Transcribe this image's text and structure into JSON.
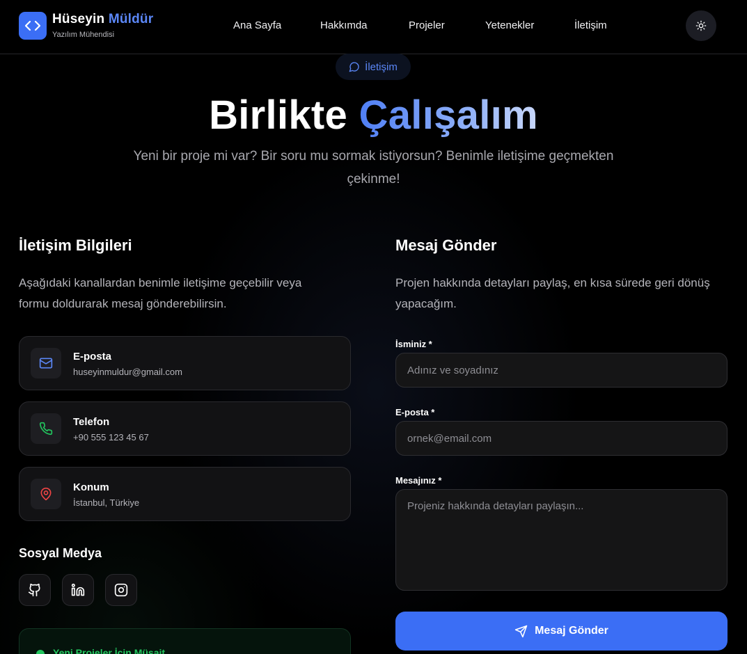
{
  "brand": {
    "first_name": "Hüseyin",
    "last_name": "Müldür",
    "subtitle": "Yazılım Mühendisi",
    "accent_color": "#3b6ef5"
  },
  "nav": {
    "links": [
      "Ana Sayfa",
      "Hakkımda",
      "Projeler",
      "Yetenekler",
      "İletişim"
    ],
    "theme_toggle_icon": "sun-icon"
  },
  "hero": {
    "badge": "İletişim",
    "badge_icon": "chat-bubble-icon",
    "title_plain": "Birlikte",
    "title_highlight": "Çalışalım",
    "subtitle": "Yeni bir proje mi var? Bir soru mu sormak istiyorsun? Benimle iletişime geçmekten çekinme!"
  },
  "contact_info": {
    "title": "İletişim Bilgileri",
    "description": "Aşağıdaki kanallardan benimle iletişime geçebilir veya formu doldurarak mesaj gönderebilirsin.",
    "items": [
      {
        "label": "E-posta",
        "value": "huseyinmuldur@gmail.com",
        "icon": "mail-icon",
        "color": "#5b87f7"
      },
      {
        "label": "Telefon",
        "value": "+90 555 123 45 67",
        "icon": "phone-icon",
        "color": "#22c55e"
      },
      {
        "label": "Konum",
        "value": "İstanbul, Türkiye",
        "icon": "map-pin-icon",
        "color": "#ef4444"
      }
    ],
    "social_title": "Sosyal Medya",
    "social": [
      "github-icon",
      "linkedin-icon",
      "instagram-icon"
    ],
    "availability": "Yeni Projeler İçin Müsait",
    "availability_color": "#22c55e"
  },
  "form": {
    "title": "Mesaj Gönder",
    "description": "Projen hakkında detayları paylaş, en kısa sürede geri dönüş yapacağım.",
    "name_label": "İsminiz *",
    "name_placeholder": "Adınız ve soyadınız",
    "email_label": "E-posta *",
    "email_placeholder": "ornek@email.com",
    "message_label": "Mesajınız *",
    "message_placeholder": "Projeniz hakkında detayları paylaşın...",
    "submit_label": "Mesaj Gönder",
    "submit_icon": "send-icon"
  }
}
